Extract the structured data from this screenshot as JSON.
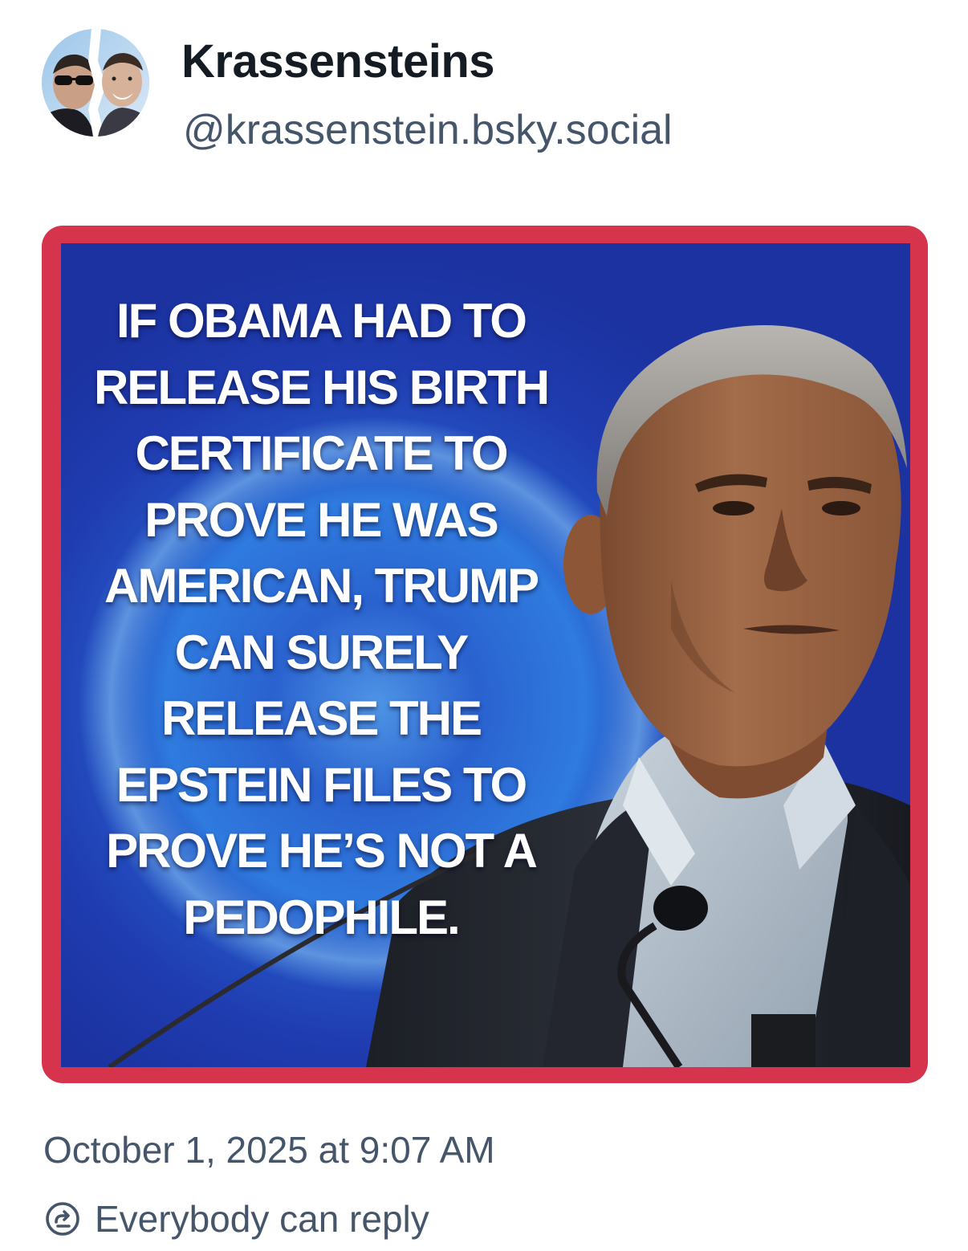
{
  "post": {
    "author": {
      "display_name": "Krassensteins",
      "handle": "@krassenstein.bsky.social",
      "avatar": "avatar-photo-two-men"
    },
    "image": {
      "border_color": "#d6334c",
      "background_color": "#1f3cb0",
      "caption_lines": [
        "IF OBAMA HAD TO",
        "RELEASE HIS BIRTH",
        "CERTIFICATE TO",
        "PROVE HE WAS",
        "AMERICAN, TRUMP",
        "CAN SURELY",
        "RELEASE THE",
        "EPSTEIN FILES TO",
        "PROVE HE’S NOT A",
        "PEDOPHILE."
      ]
    },
    "timestamp": "October 1, 2025 at 9:07 AM",
    "reply_setting": {
      "icon": "reply-permission-icon",
      "label": "Everybody can reply"
    }
  }
}
